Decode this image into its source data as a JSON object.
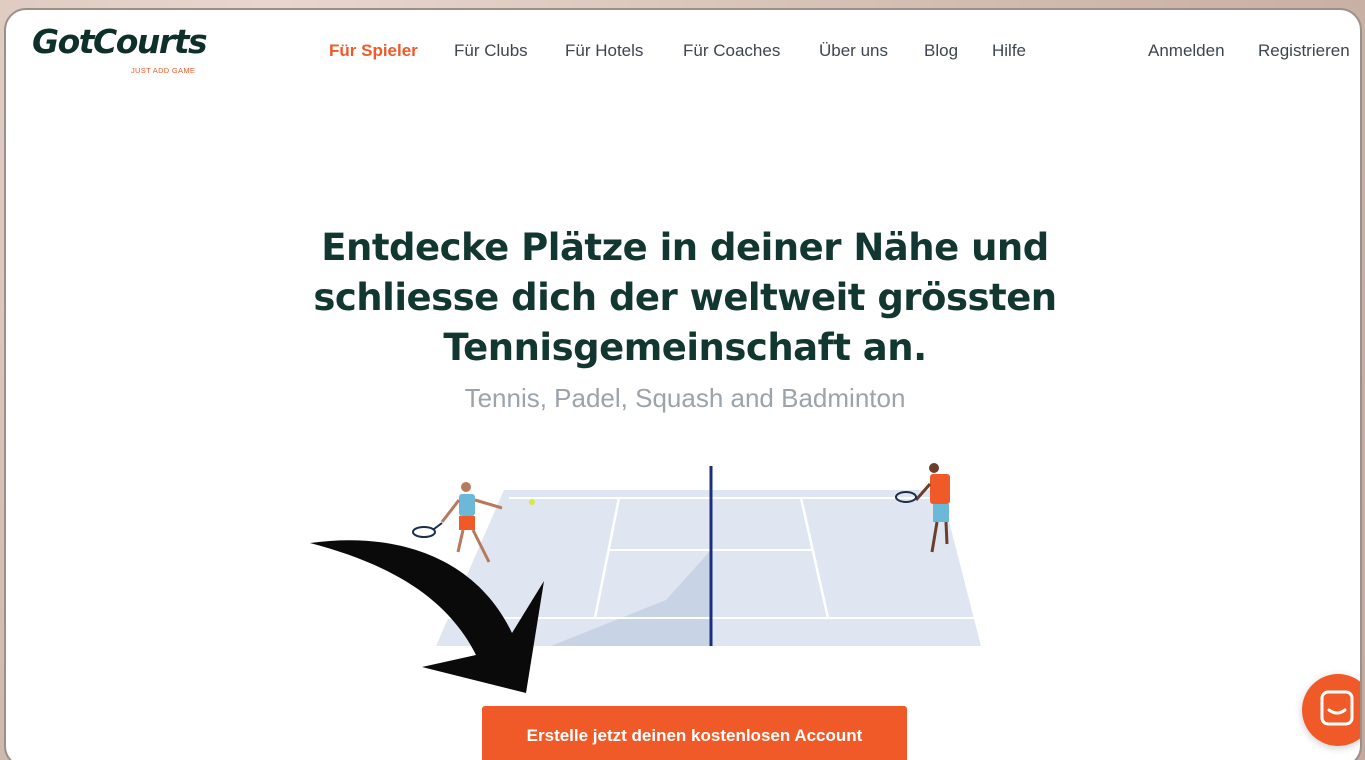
{
  "header": {
    "logo_text": "GotCourts",
    "logo_tagline": "JUST ADD GAME",
    "nav_items": [
      {
        "label": "Für Spieler",
        "active": true
      },
      {
        "label": "Für Clubs"
      },
      {
        "label": "Für Hotels"
      },
      {
        "label": "Für Coaches"
      },
      {
        "label": "Über uns"
      },
      {
        "label": "Blog"
      },
      {
        "label": "Hilfe"
      }
    ],
    "login_label": "Anmelden",
    "register_label": "Registrieren"
  },
  "hero": {
    "title_lines": [
      "Entdecke Plätze in deiner Nähe und",
      "schliesse dich der weltweit grössten",
      "Tennisgemeinschaft an."
    ],
    "subtitle": "Tennis, Padel, Squash and Badminton",
    "cta_label": "Erstelle jetzt deinen kostenlosen Account"
  },
  "colors": {
    "accent": "#f05a28",
    "heading": "#123731",
    "nav_text": "#3d4650",
    "subtitle": "#9ba3ab",
    "court": "#dfe6f2",
    "net": "#1c2f7a"
  },
  "icons": {
    "chat": "chat-bubble-icon",
    "arrow": "curved-arrow-annotation"
  }
}
